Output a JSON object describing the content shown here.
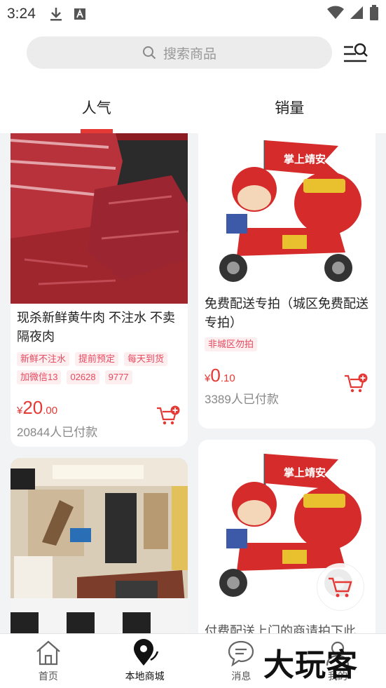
{
  "status_bar": {
    "time": "3:24"
  },
  "search": {
    "placeholder": "搜索商品"
  },
  "tabs": [
    {
      "label": "人气",
      "active": true
    },
    {
      "label": "销量",
      "active": false
    }
  ],
  "products": [
    {
      "title": "现杀新鲜黄牛肉 不注水 不卖隔夜肉",
      "tags": [
        "新鲜不注水",
        "提前预定",
        "每天到货",
        "加微信13",
        "02628",
        "9777"
      ],
      "price_symbol": "¥",
      "price_int": "20",
      "price_dec": ".00",
      "sold": "20844人已付款",
      "image": "beef"
    },
    {
      "title": "免费配送专拍（城区免费配送专拍）",
      "tags": [
        "非城区勿拍"
      ],
      "price_symbol": "¥",
      "price_int": "0",
      "price_dec": ".10",
      "sold": "3389人已付款",
      "image": "delivery-rider",
      "flag_text": "掌上靖安"
    },
    {
      "title": "",
      "image": "room-interior"
    },
    {
      "title": "付费配送上门的商请拍下此",
      "image": "delivery-rider",
      "flag_text": "掌上靖安"
    }
  ],
  "bottom_nav": [
    {
      "label": "首页",
      "icon": "home-icon",
      "active": false
    },
    {
      "label": "本地商城",
      "icon": "location-icon",
      "active": true
    },
    {
      "label": "消息",
      "icon": "chat-icon",
      "active": false
    },
    {
      "label": "我的",
      "icon": "user-icon",
      "active": false
    }
  ],
  "watermark": "大玩客",
  "colors": {
    "accent": "#e53935",
    "tag_bg": "#fdeef0",
    "tag_text": "#e84a5f"
  }
}
